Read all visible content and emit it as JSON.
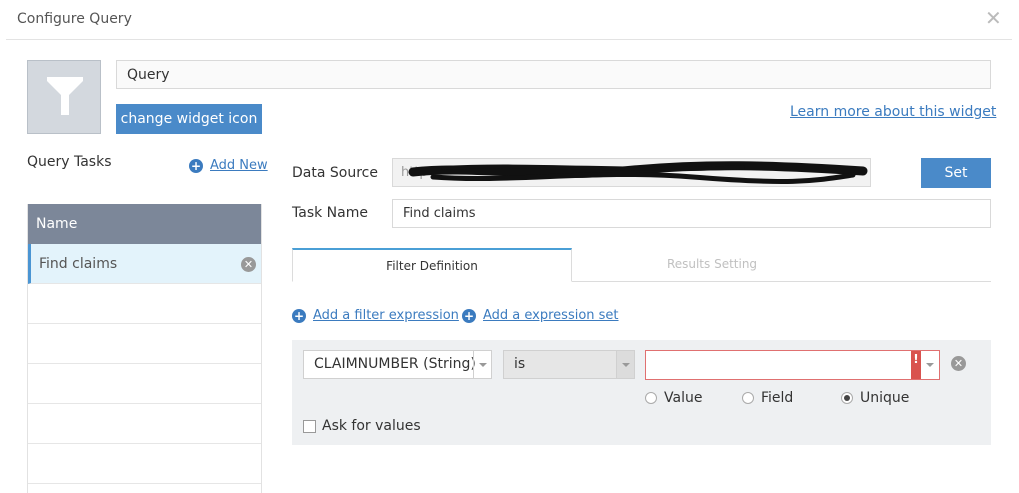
{
  "dialog": {
    "title": "Configure Query",
    "close_glyph": "✕"
  },
  "widget": {
    "icon": "funnel-icon",
    "name_value": "Query",
    "change_icon_label": "change widget icon",
    "learn_more_label": "Learn more about this widget"
  },
  "tasks": {
    "label": "Query Tasks",
    "add_new_label": "Add New",
    "header": "Name",
    "items": [
      {
        "name": "Find claims",
        "selected": true
      }
    ]
  },
  "form": {
    "data_source_label": "Data Source",
    "data_source_value": "http",
    "set_label": "Set",
    "task_name_label": "Task Name",
    "task_name_value": "Find claims"
  },
  "tabs": [
    {
      "label": "Filter Definition",
      "active": true
    },
    {
      "label": "Results Setting",
      "active": false
    }
  ],
  "filter": {
    "add_filter_label": "Add a filter expression",
    "add_set_label": "Add a expression set",
    "field_value": "CLAIMNUMBER (String)",
    "operator_value": "is",
    "value_input": "",
    "error_glyph": "!",
    "radio_options": [
      {
        "label": "Value",
        "checked": false
      },
      {
        "label": "Field",
        "checked": false
      },
      {
        "label": "Unique",
        "checked": true
      }
    ],
    "ask_for_values_label": "Ask for values"
  },
  "colors": {
    "primary_button": "#4a8ac9",
    "link": "#3b7bbf",
    "table_header": "#7c8799",
    "selected_row": "#e3f3fb",
    "error": "#d9534f"
  }
}
